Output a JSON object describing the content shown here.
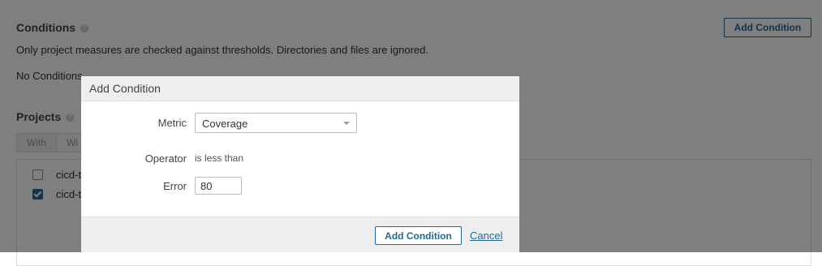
{
  "conditions": {
    "title": "Conditions",
    "help_icon_text": "?",
    "add_button": "Add Condition",
    "description": "Only project measures are checked against thresholds. Directories and files are ignored.",
    "empty_text": "No Conditions"
  },
  "projects": {
    "title": "Projects",
    "help_icon_text": "?",
    "tabs": [
      {
        "label": "With",
        "selected": true
      },
      {
        "label": "Wi",
        "selected": false
      }
    ],
    "items": [
      {
        "name": "cicd-te",
        "checked": false
      },
      {
        "name": "cicd-te",
        "checked": true
      }
    ]
  },
  "modal": {
    "title": "Add Condition",
    "metric_label": "Metric",
    "metric_value": "Coverage",
    "operator_label": "Operator",
    "operator_value": "is less than",
    "error_label": "Error",
    "error_value": "80",
    "submit_label": "Add Condition",
    "cancel_label": "Cancel"
  },
  "colors": {
    "accent": "#236a97",
    "overlay": "rgba(0,0,0,0.5)"
  }
}
